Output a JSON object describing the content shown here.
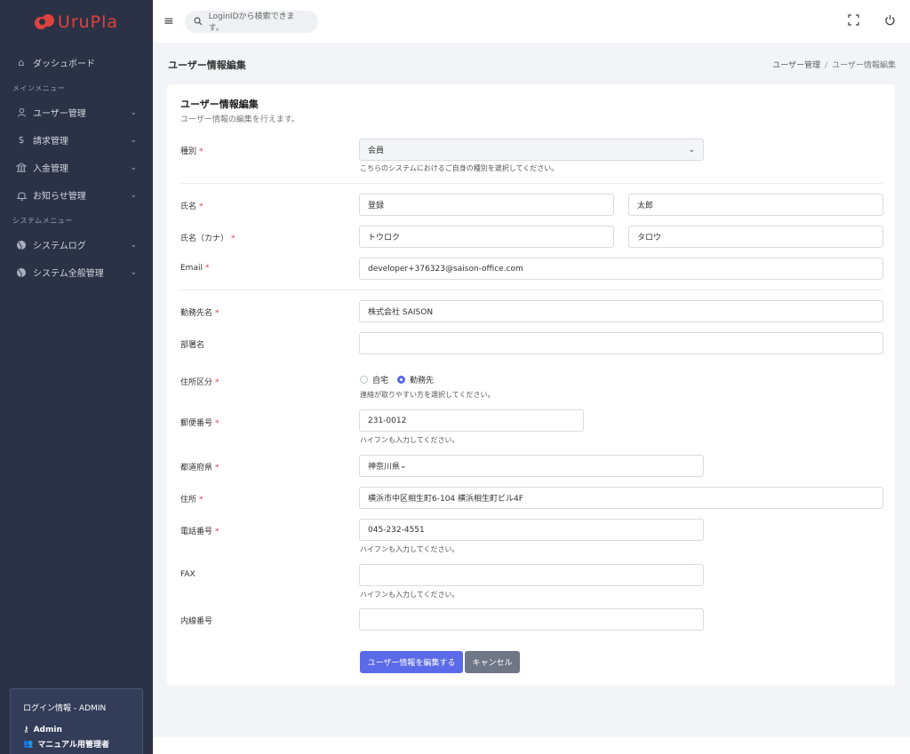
{
  "app": {
    "logo_text": "UruPla"
  },
  "sidebar": {
    "dashboard": "ダッシュボード",
    "section_main": "メインメニュー",
    "main_items": [
      {
        "label": "ユーザー管理",
        "icon": "user-icon"
      },
      {
        "label": "請求管理",
        "icon": "dollar-icon"
      },
      {
        "label": "入金管理",
        "icon": "bank-icon"
      },
      {
        "label": "お知らせ管理",
        "icon": "bell-icon"
      }
    ],
    "section_system": "システムメニュー",
    "system_items": [
      {
        "label": "システムログ",
        "icon": "globe-icon"
      },
      {
        "label": "システム全般管理",
        "icon": "globe-icon"
      }
    ],
    "login": {
      "title": "ログイン情報 - ADMIN",
      "user": "Admin",
      "role": "マニュアル用管理者"
    }
  },
  "topbar": {
    "search_placeholder": "LoginIDから検索できます。"
  },
  "page": {
    "title": "ユーザー情報編集",
    "breadcrumb": {
      "parent": "ユーザー管理",
      "current": "ユーザー情報編集"
    }
  },
  "form": {
    "title": "ユーザー情報編集",
    "subtitle": "ユーザー情報の編集を行えます。",
    "type": {
      "label": "種別",
      "value": "会員",
      "hint": "こちらのシステムにおけるご自身の種別を選択してください。"
    },
    "name": {
      "label": "氏名",
      "last": "登録",
      "first": "太郎"
    },
    "kana": {
      "label": "氏名（カナ）",
      "last": "トウロク",
      "first": "タロウ"
    },
    "email": {
      "label": "Email",
      "value": "developer+376323@saison-office.com"
    },
    "company": {
      "label": "勤務先名",
      "value": "株式会社 SAISON"
    },
    "department": {
      "label": "部署名",
      "value": ""
    },
    "address_type": {
      "label": "住所区分",
      "options": [
        "自宅",
        "勤務先"
      ],
      "selected": "勤務先",
      "hint": "連絡が取りやすい方を選択してください。"
    },
    "zip": {
      "label": "郵便番号",
      "value": "231-0012",
      "hint": "ハイフンも入力してください。"
    },
    "prefecture": {
      "label": "都道府県",
      "value": "神奈川県"
    },
    "address": {
      "label": "住所",
      "value": "横浜市中区相生町6-104 横浜相生町ビル4F"
    },
    "phone": {
      "label": "電話番号",
      "value": "045-232-4551",
      "hint": "ハイフンも入力してください。"
    },
    "fax": {
      "label": "FAX",
      "value": "",
      "hint": "ハイフンも入力してください。"
    },
    "extension": {
      "label": "内線番号",
      "value": ""
    },
    "submit_label": "ユーザー情報を編集する",
    "cancel_label": "キャンセル"
  },
  "colors": {
    "sidebar_bg": "#2b3245",
    "primary": "#5b6ae8",
    "required": "#e0423f"
  }
}
